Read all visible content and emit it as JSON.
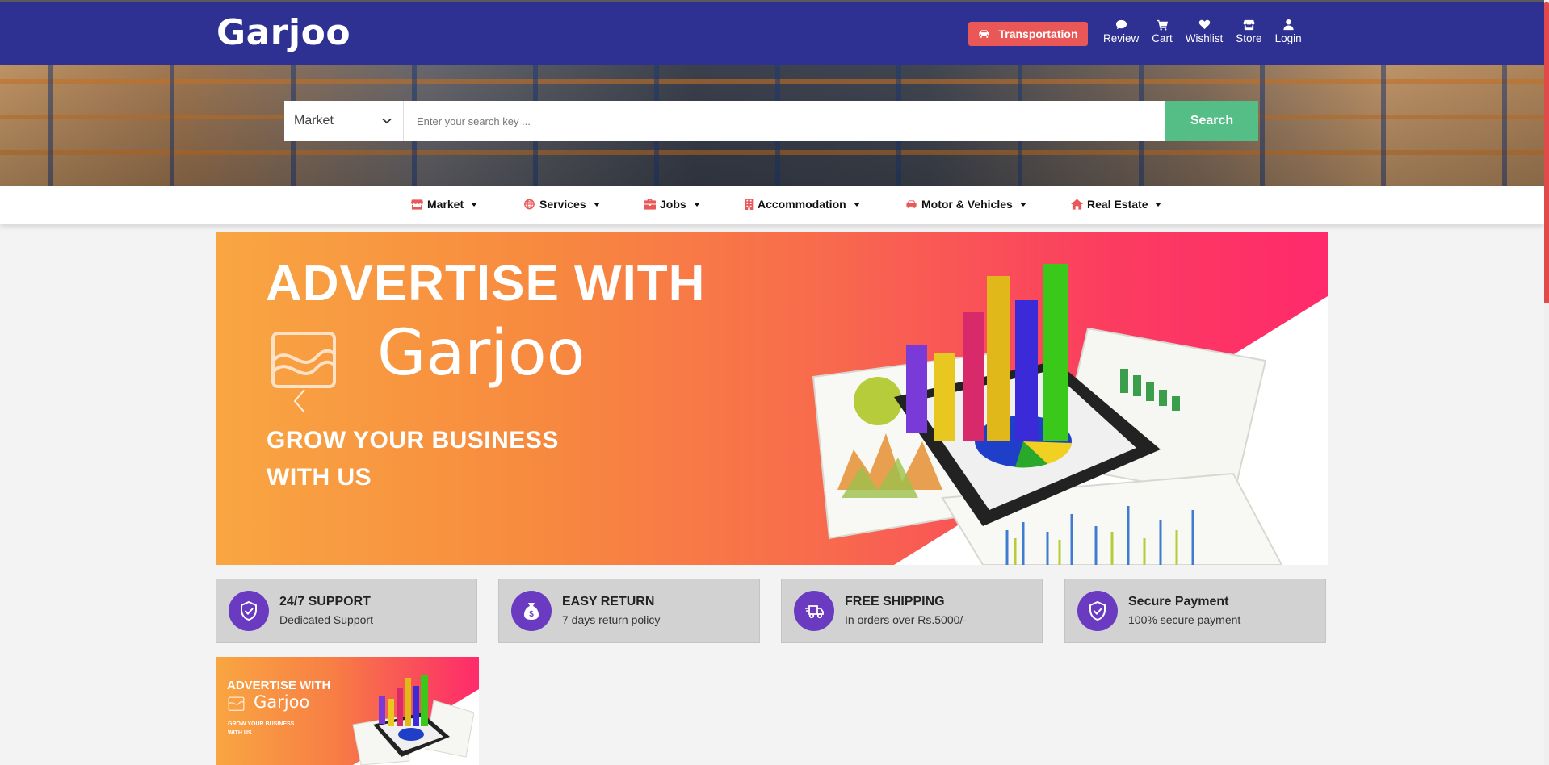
{
  "header": {
    "logo": "Garjoo",
    "transport_button": "Transportation",
    "nav": [
      {
        "label": "Review",
        "icon": "comment-icon"
      },
      {
        "label": "Cart",
        "icon": "cart-icon"
      },
      {
        "label": "Wishlist",
        "icon": "heart-icon"
      },
      {
        "label": "Store",
        "icon": "store-icon"
      },
      {
        "label": "Login",
        "icon": "user-icon"
      }
    ]
  },
  "search": {
    "category_selected": "Market",
    "placeholder": "Enter your search key ...",
    "button_label": "Search"
  },
  "categories": [
    {
      "label": "Market",
      "icon": "store-icon"
    },
    {
      "label": "Services",
      "icon": "globe-icon"
    },
    {
      "label": "Jobs",
      "icon": "briefcase-icon"
    },
    {
      "label": "Accommodation",
      "icon": "building-icon"
    },
    {
      "label": "Motor & Vehicles",
      "icon": "car-icon"
    },
    {
      "label": "Real Estate",
      "icon": "home-icon"
    }
  ],
  "banner": {
    "title": "ADVERTISE WITH",
    "brand": "Garjoo",
    "subtitle_line1": "GROW YOUR BUSINESS",
    "subtitle_line2": "WITH US"
  },
  "features": [
    {
      "title": "24/7 SUPPORT",
      "desc": "Dedicated Support",
      "icon": "shield-check-icon"
    },
    {
      "title": "EASY RETURN",
      "desc": "7 days return policy",
      "icon": "money-bag-icon"
    },
    {
      "title": "FREE SHIPPING",
      "desc": "In orders over Rs.5000/-",
      "icon": "truck-icon"
    },
    {
      "title": "Secure Payment",
      "desc": "100% secure payment",
      "icon": "shield-check-icon"
    }
  ],
  "small_ad": {
    "title": "ADVERTISE WITH",
    "brand": "Garjoo",
    "subtitle_line1": "GROW YOUR BUSINESS",
    "subtitle_line2": "WITH US"
  },
  "colors": {
    "header_bg": "#2e3192",
    "accent_red": "#e95757",
    "search_green": "#55bd86",
    "feature_icon_purple": "#6a3bc1"
  }
}
